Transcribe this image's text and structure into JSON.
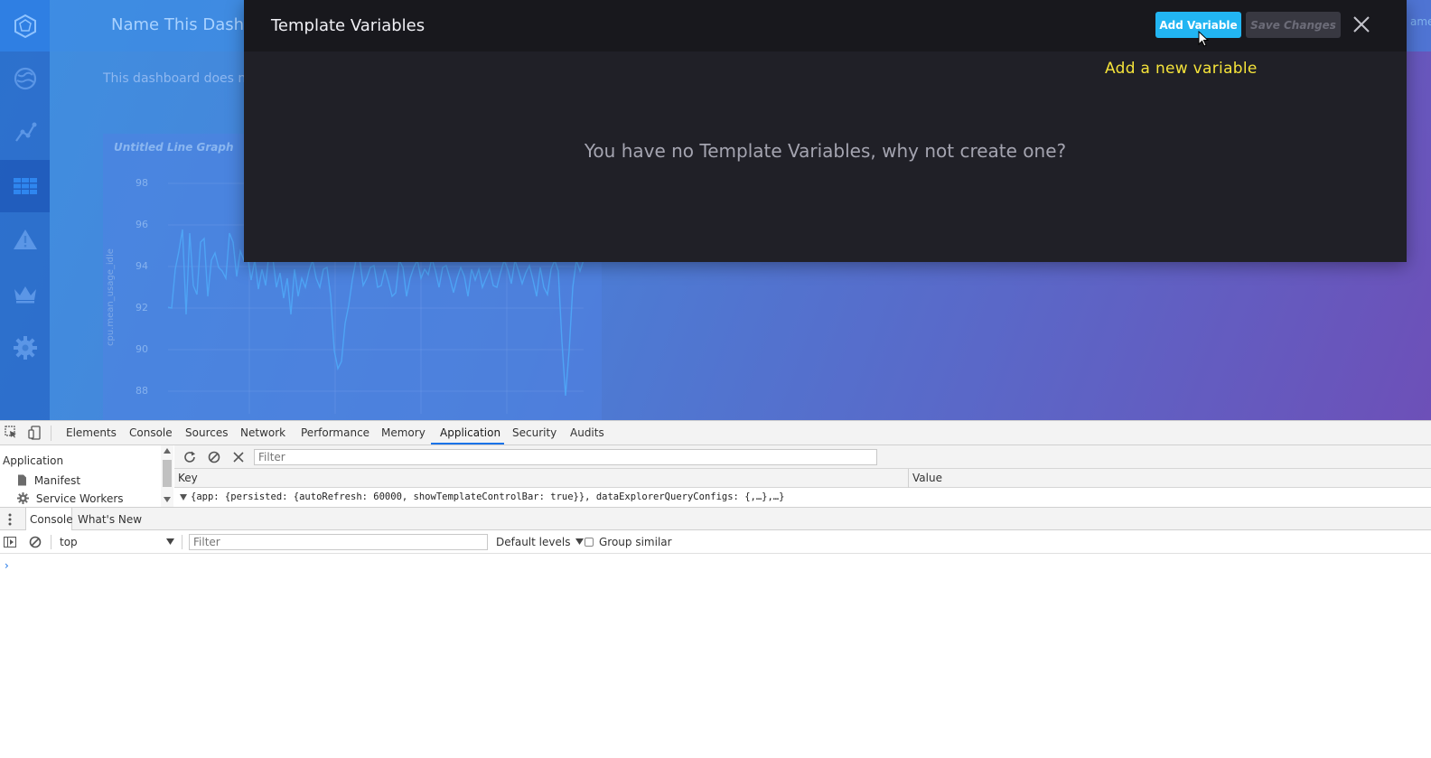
{
  "dashboard": {
    "title": "Name This Dashb",
    "notice": "This dashboard does not",
    "right_edge_text": "ame C"
  },
  "graph": {
    "title": "Untitled Line Graph",
    "ylabel": "cpu.mean_usage_idle",
    "yticks": [
      "98",
      "96",
      "94",
      "92",
      "90",
      "88"
    ],
    "line_color": "#4ea4f5"
  },
  "sidebar": {
    "items": [
      {
        "icon": "logo-icon"
      },
      {
        "icon": "globe-icon"
      },
      {
        "icon": "graph-icon"
      },
      {
        "icon": "dashboards-icon",
        "active": true
      },
      {
        "icon": "alert-icon"
      },
      {
        "icon": "crown-icon"
      },
      {
        "icon": "gear-icon"
      }
    ]
  },
  "modal": {
    "title": "Template Variables",
    "add_label": "Add Variable",
    "save_label": "Save Changes",
    "tooltip": "Add a new variable",
    "empty_message": "You have no Template Variables, why not create one?",
    "accent": "#22b5f2",
    "tooltip_color": "#f5e33a"
  },
  "devtools": {
    "tabs": [
      "Elements",
      "Console",
      "Sources",
      "Network",
      "Performance",
      "Memory",
      "Application",
      "Security",
      "Audits"
    ],
    "active_tab": "Application",
    "app_panel": {
      "title": "Application",
      "items": [
        "Manifest",
        "Service Workers"
      ]
    },
    "storage": {
      "filter_placeholder": "Filter",
      "key_header": "Key",
      "value_header": "Value",
      "row": "{app: {persisted: {autoRefresh: 60000, showTemplateControlBar: true}}, dataExplorerQueryConfigs: {,…},…}"
    },
    "drawer": {
      "tabs": [
        "Console",
        "What's New"
      ]
    },
    "console": {
      "context": "top",
      "filter_placeholder": "Filter",
      "levels": "Default levels",
      "group_similar": "Group similar",
      "prompt": "›"
    }
  }
}
